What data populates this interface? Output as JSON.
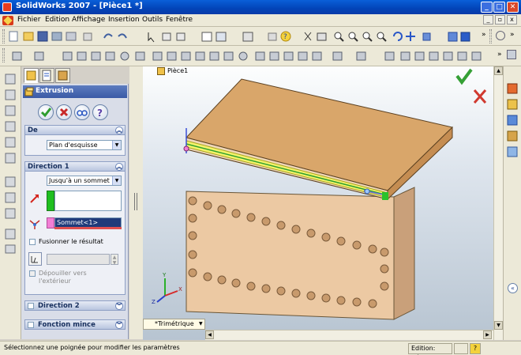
{
  "window": {
    "title": "SolidWorks 2007 - [Pièce1 *]"
  },
  "menubar": {
    "items": [
      "Fichier",
      "Edition",
      "Affichage",
      "Insertion",
      "Outils",
      "Fenêtre"
    ]
  },
  "pm": {
    "title": "Extrusion",
    "from_group": {
      "header": "De",
      "start_condition": "Plan d'esquisse"
    },
    "direction1": {
      "header": "Direction 1",
      "end_condition": "Jusqu'à un sommet",
      "vertex_value": "Sommet<1>",
      "merge_label": "Fusionner le résultat",
      "draft_label": "Dépouiller vers l'extérieur"
    },
    "direction2": {
      "header": "Direction 2"
    },
    "thin": {
      "header": "Fonction mince"
    }
  },
  "viewport": {
    "tree_label": "Pièce1",
    "view_tab": "*Trimétrique"
  },
  "statusbar": {
    "message": "Sélectionnez une poignée pour modifier les paramètres",
    "mode": "Edition: Pièce",
    "help": "?"
  },
  "colors": {
    "title_bar": "#0a4fd0",
    "top_face": "#d9a66a",
    "front_face": "#ecc9a3",
    "highlight": "#f4f36b",
    "ok_green": "#2e9d2e",
    "cancel_red": "#c82a2a"
  }
}
